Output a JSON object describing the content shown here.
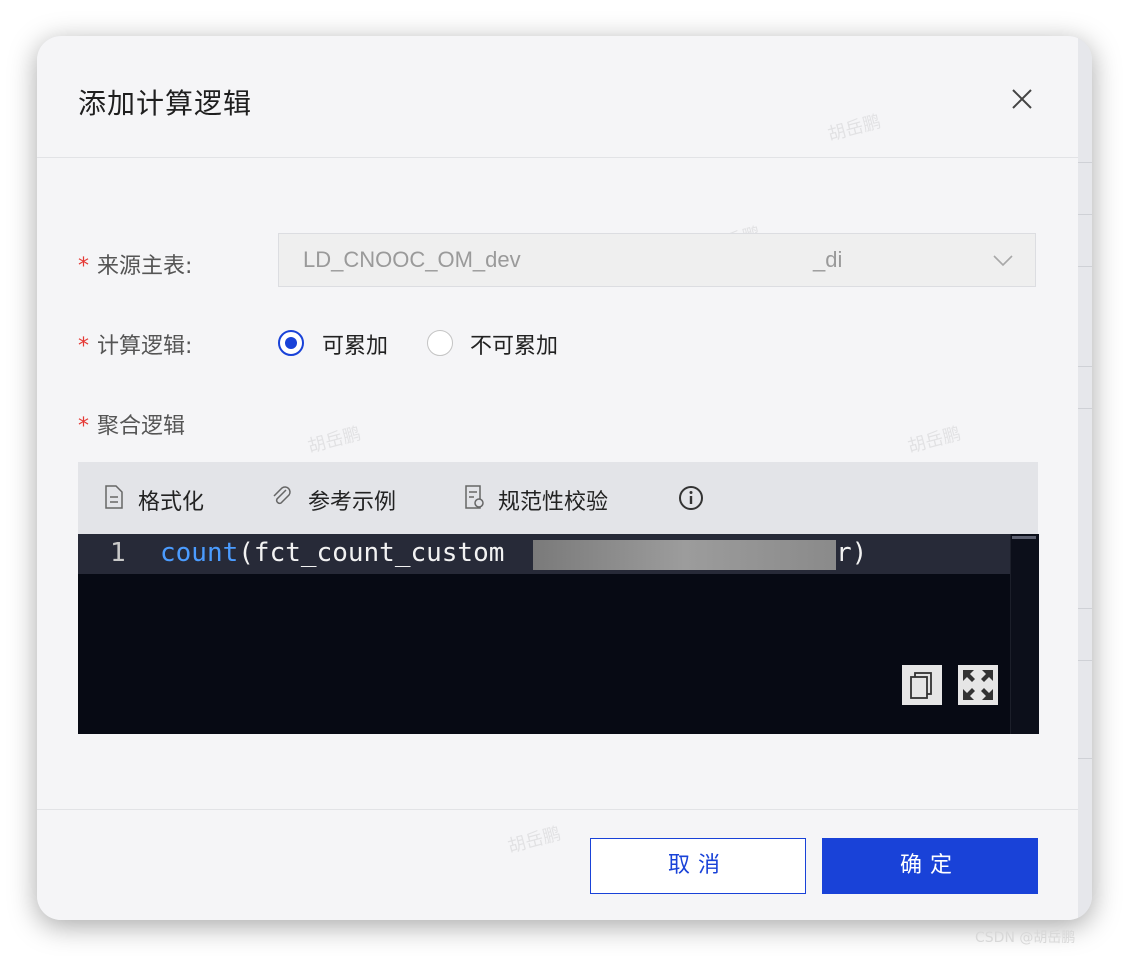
{
  "dialog": {
    "title": "添加计算逻辑",
    "watermark": "胡岳鹏"
  },
  "form": {
    "source_table": {
      "label": "来源主表:",
      "value_prefix": "LD_CNOOC_OM_dev",
      "value_suffix": "_di"
    },
    "calc_logic": {
      "label": "计算逻辑:",
      "options": [
        {
          "label": "可累加",
          "selected": true
        },
        {
          "label": "不可累加",
          "selected": false
        }
      ]
    },
    "agg_logic": {
      "label": "聚合逻辑"
    },
    "required_mark": "*"
  },
  "toolbar": {
    "format": "格式化",
    "example": "参考示例",
    "validate": "规范性校验",
    "info_icon": "info-icon"
  },
  "editor": {
    "line_number": "1",
    "keyword": "count",
    "code_visible": "(fct_count_custom",
    "code_tail": "r)"
  },
  "footer": {
    "cancel": "取消",
    "confirm": "确定"
  },
  "credit": "CSDN @胡岳鹏",
  "colors": {
    "primary": "#1942d8",
    "required": "#e53935",
    "editor_bg": "#070a14"
  }
}
